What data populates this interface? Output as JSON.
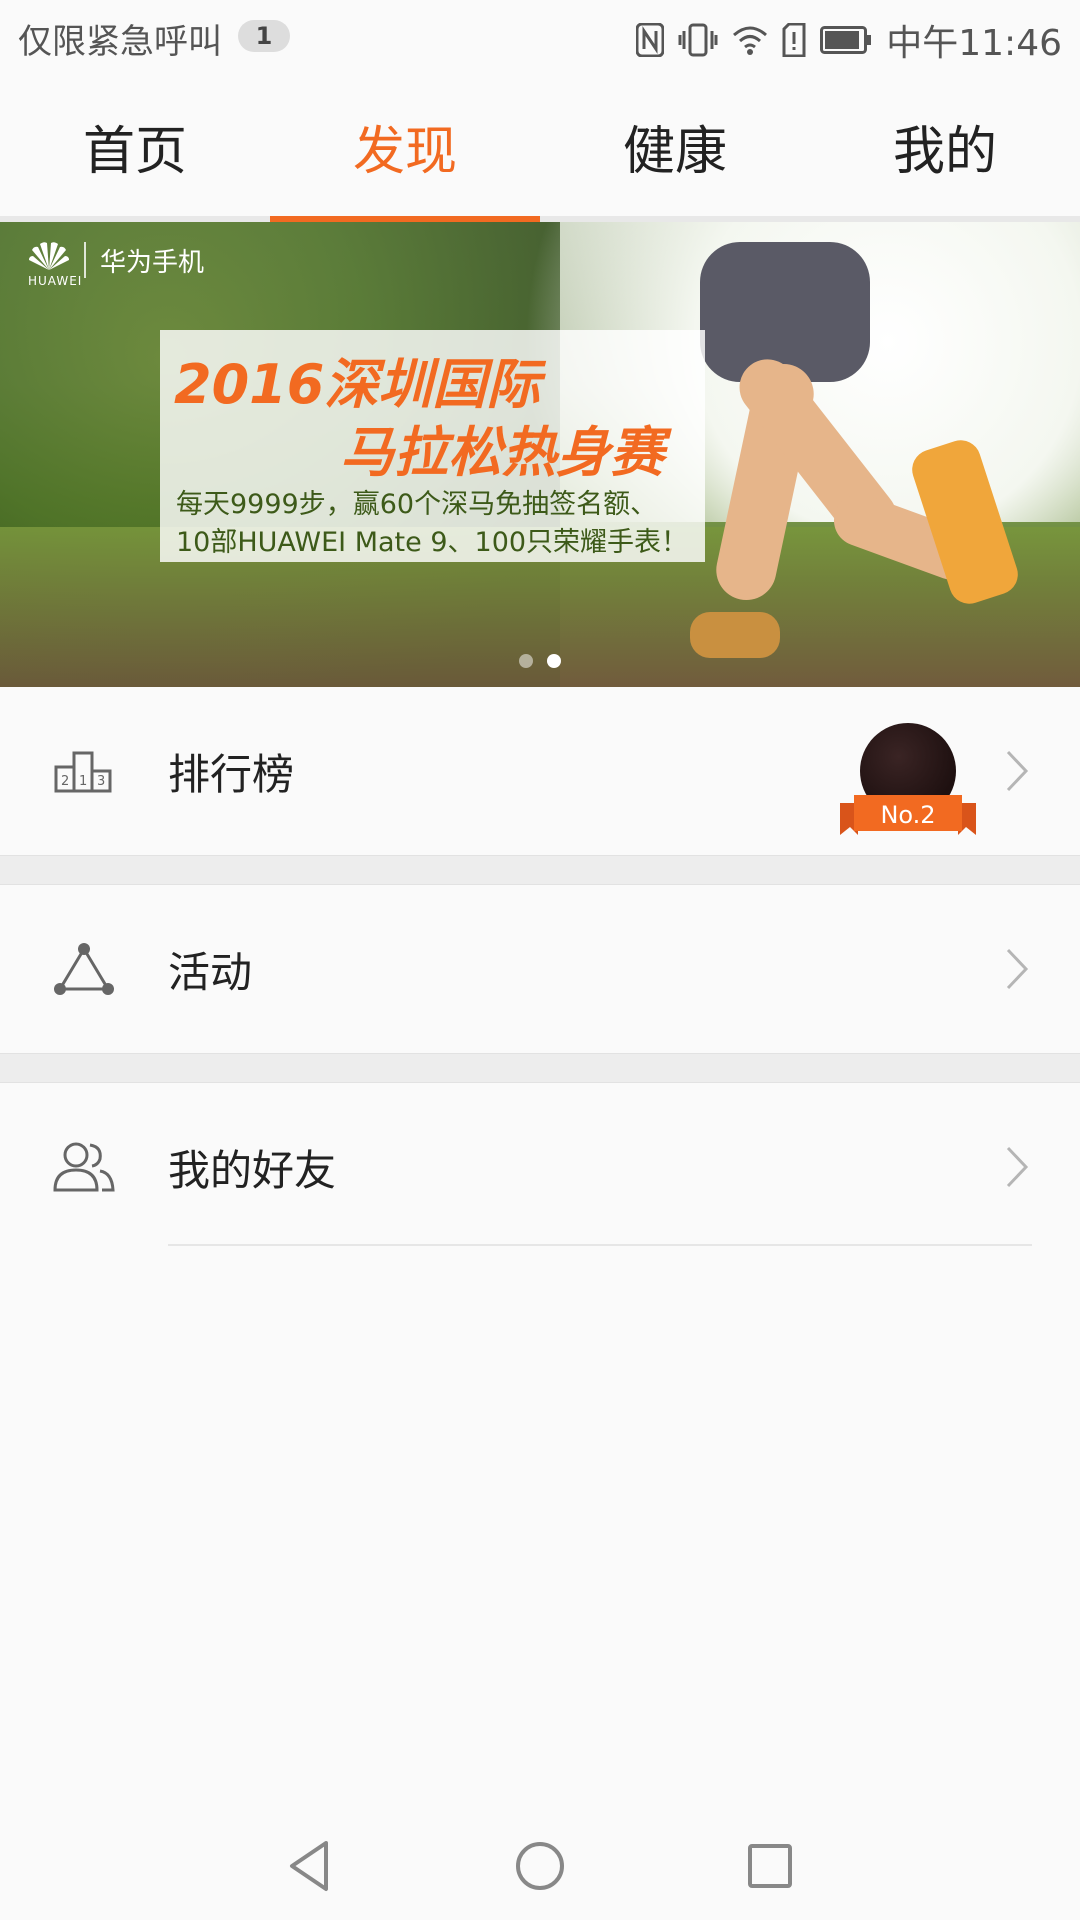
{
  "status_bar": {
    "carrier": "仅限紧急呼叫",
    "sim_badge": "1",
    "time": "中午11:46",
    "icons": [
      "nfc-icon",
      "vibrate-icon",
      "wifi-icon",
      "sim-alert-icon",
      "battery-icon"
    ]
  },
  "tabs": [
    {
      "label": "首页",
      "active": false
    },
    {
      "label": "发现",
      "active": true
    },
    {
      "label": "健康",
      "active": false
    },
    {
      "label": "我的",
      "active": false
    }
  ],
  "banner": {
    "brand_word": "HUAWEI",
    "brand_text": "华为手机",
    "title_line1": "2016深圳国际",
    "title_line2": "马拉松热身赛",
    "desc_line1": "每天9999步，赢60个深马免抽签名额、",
    "desc_line2": "10部HUAWEI Mate 9、100只荣耀手表！",
    "page_count": 2,
    "active_page": 2
  },
  "list": {
    "ranking": {
      "label": "排行榜",
      "icon": "podium-icon",
      "rank_badge": "No.2"
    },
    "activity": {
      "label": "活动",
      "icon": "triangle-nodes-icon"
    },
    "friends": {
      "label": "我的好友",
      "icon": "friends-icon"
    }
  },
  "colors": {
    "accent": "#f26a21"
  }
}
